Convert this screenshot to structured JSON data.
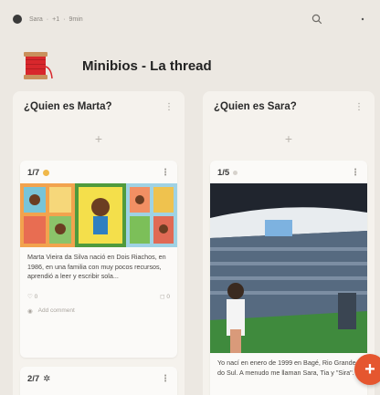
{
  "topbar": {
    "author": "Sara",
    "count": "+1",
    "time": "9min",
    "separator": "·"
  },
  "header": {
    "title": "Minibios - La thread"
  },
  "columns": [
    {
      "title": "¿Quien es Marta?",
      "cards": [
        {
          "index": "1/7",
          "text": "Marta Vieira da Silva nació en Dois Riachos, en 1986, en una familia con muy pocos recursos, aprendió a leer y escribir sola...",
          "likes": "0",
          "comments": "0",
          "comment_placeholder": "Add comment"
        },
        {
          "index": "2/7",
          "text": ""
        }
      ]
    },
    {
      "title": "¿Quien es Sara?",
      "cards": [
        {
          "index": "1/5",
          "text": "Yo nací en enero de 1999 en Bagé, Rio Grande do Sul. A menudo me llaman Sara, Tia y \"Sira\"."
        }
      ]
    }
  ],
  "fab": {
    "label": "+"
  },
  "colors": {
    "accent": "#e5562f",
    "background": "#ece8e2",
    "column": "#f5f2ed",
    "card": "#fbfaf8"
  }
}
